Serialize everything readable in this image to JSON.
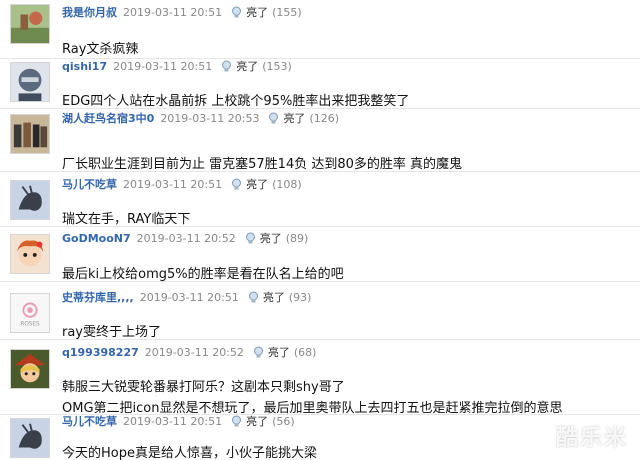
{
  "like_label": "亮了",
  "posts": [
    {
      "username": "我是你月叔",
      "time": "2019-03-11 20:51",
      "likes": "(155)",
      "lines": [
        "Ray文杀疯辣"
      ],
      "avatar": "avatar-green-field"
    },
    {
      "username": "qishi17",
      "time": "2019-03-11 20:51",
      "likes": "(153)",
      "lines": [
        "EDG四个人站在水晶前拆 上校跳个95%胜率出来把我整笑了"
      ],
      "avatar": "avatar-masked-face"
    },
    {
      "username": "湖人赶鸟名宿3中0",
      "time": "2019-03-11 20:53",
      "likes": "(126)",
      "lines": [
        "厂长职业生涯到目前为止 雷克塞57胜14负 达到80多的胜率 真的魔鬼"
      ],
      "avatar": "avatar-group-photo"
    },
    {
      "username": "马儿不吃草",
      "time": "2019-03-11 20:51",
      "likes": "(108)",
      "lines": [
        "瑞文在手，RAY临天下"
      ],
      "avatar": "avatar-horse-sketch"
    },
    {
      "username": "GoDMooN7",
      "time": "2019-03-11 20:52",
      "likes": "(89)",
      "lines": [
        "最后ki上校给omg5%的胜率是看在队名上给的吧"
      ],
      "avatar": "avatar-cartoon-girl"
    },
    {
      "username": "史蒂芬库里,,,,",
      "time": "2019-03-11 20:51",
      "likes": "(93)",
      "lines": [
        "ray雯终于上场了"
      ],
      "avatar": "avatar-roses-logo"
    },
    {
      "username": "q199398227",
      "time": "2019-03-11 20:52",
      "likes": "(68)",
      "lines": [
        "韩服三大锐雯轮番暴打阿乐？这剧本只剩shy哥了",
        "OMG第二把icon显然是不想玩了，最后加里奥带队上去四打五也是赶紧推完拉倒的意思"
      ],
      "avatar": "avatar-anime-hat"
    },
    {
      "username": "马儿不吃草",
      "time": "2019-03-11 20:51",
      "likes": "(56)",
      "lines": [
        "今天的Hope真是给人惊喜，小伙子能挑大梁"
      ],
      "avatar": "avatar-horse-sketch"
    }
  ],
  "avatar_logo_text": "ROSES",
  "watermark": "酷乐米"
}
